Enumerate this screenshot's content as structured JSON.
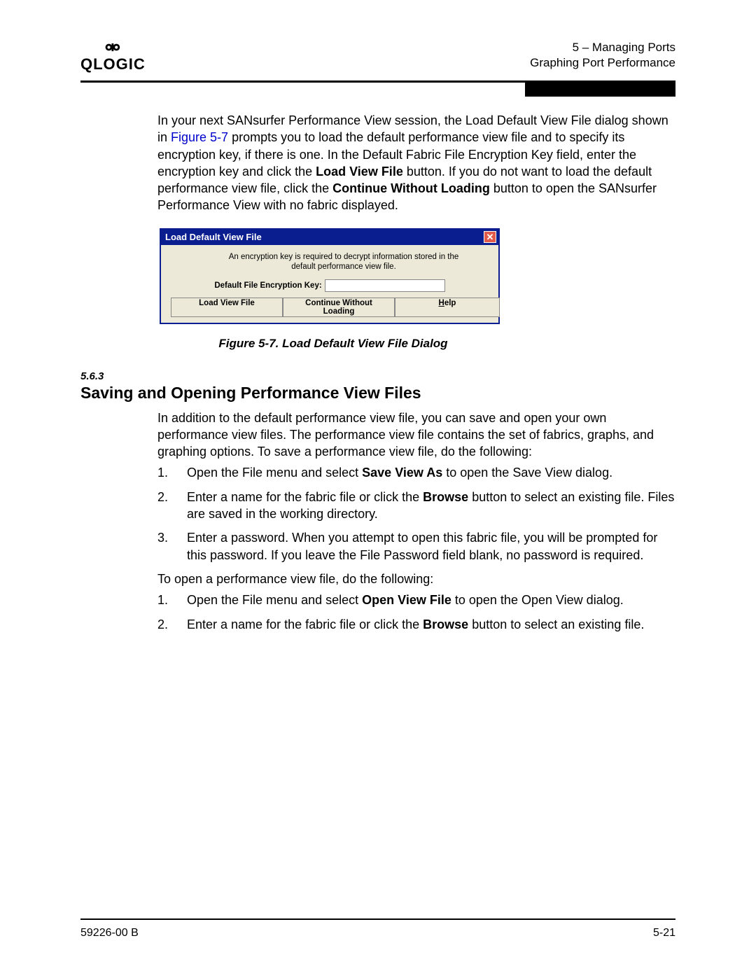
{
  "header": {
    "logo_glyph": "⚮",
    "logo_text": "QLOGIC",
    "right_line1": "5 – Managing Ports",
    "right_line2": "Graphing Port Performance"
  },
  "para1": {
    "t1": "In your next SANsurfer Performance View session, the Load Default View File dialog shown in ",
    "link": "Figure 5-7",
    "t2": " prompts you to load the default performance view file and to specify its encryption key, if there is one. In the Default Fabric File Encryption Key field, enter the encryption key and click the ",
    "b1": "Load View File",
    "t3": " button. If you do not want to load the default performance view file, click the ",
    "b2": "Continue Without Loading",
    "t4": " button to open the SANsurfer Performance View with no fabric displayed."
  },
  "dialog": {
    "title": "Load Default View File",
    "msg": "An encryption key is required to decrypt information stored in the default performance view file.",
    "key_label": "Default File Encryption Key:",
    "btn_load": "Load View File",
    "btn_cont": "Continue Without Loading",
    "btn_help_u": "H",
    "btn_help_rest": "elp"
  },
  "figcap": "Figure 5-7.  Load Default View File Dialog",
  "sec_num": "5.6.3",
  "sec_title": "Saving and Opening Performance View Files",
  "para2": "In addition to the default performance view file, you can save and open your own performance view files. The performance view file contains the set of fabrics, graphs, and graphing options. To save a performance view file, do the following:",
  "save_steps": [
    {
      "n": "1.",
      "pre": "Open the File menu and select ",
      "b": "Save View As",
      "post": " to open the Save View dialog."
    },
    {
      "n": "2.",
      "pre": "Enter a name for the fabric file or click the ",
      "b": "Browse",
      "post": " button to select an existing file. Files are saved in the working directory."
    },
    {
      "n": "3.",
      "pre": "Enter a password. When you attempt to open this fabric file, you will be prompted for this password. If you leave the File Password field blank, no password is required.",
      "b": "",
      "post": ""
    }
  ],
  "para3": "To open a performance view file, do the following:",
  "open_steps": [
    {
      "n": "1.",
      "pre": "Open the File menu and select ",
      "b": "Open View File",
      "post": " to open the Open View dialog."
    },
    {
      "n": "2.",
      "pre": "Enter a name for the fabric file or click the ",
      "b": "Browse",
      "post": " button to select an existing file."
    }
  ],
  "footer": {
    "left": "59226-00 B",
    "right": "5-21"
  }
}
